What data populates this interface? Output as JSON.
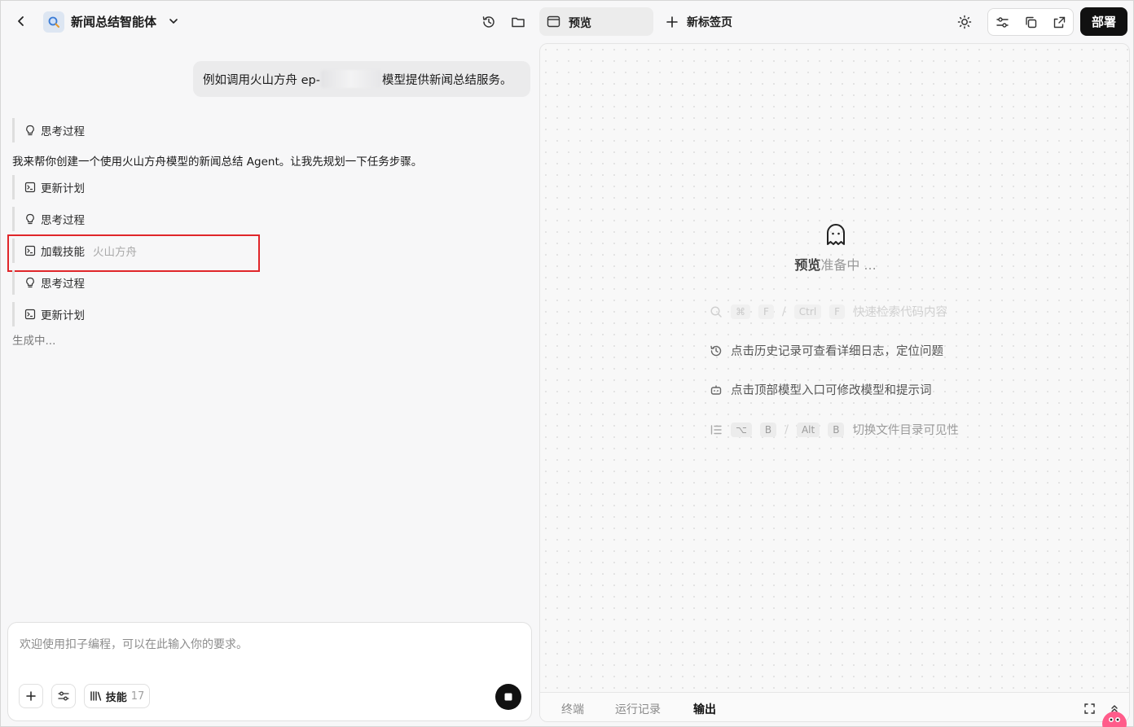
{
  "header": {
    "app_title": "新闻总结智能体",
    "tab_preview": "预览",
    "tab_new": "新标签页",
    "deploy_label": "部署"
  },
  "chat": {
    "user_message_before": "例如调用火山方舟 ep-",
    "user_message_after": "模型提供新闻总结服务。",
    "steps": [
      {
        "icon": "lightbulb-icon",
        "label": "思考过程",
        "extra": ""
      },
      {
        "icon": "terminal-icon",
        "label": "更新计划",
        "extra": ""
      },
      {
        "icon": "lightbulb-icon",
        "label": "思考过程",
        "extra": ""
      },
      {
        "icon": "terminal-icon",
        "label": "加载技能",
        "extra": "火山方舟"
      },
      {
        "icon": "lightbulb-icon",
        "label": "思考过程",
        "extra": ""
      },
      {
        "icon": "terminal-icon",
        "label": "更新计划",
        "extra": ""
      }
    ],
    "assistant_reply": "我来帮你创建一个使用火山方舟模型的新闻总结 Agent。让我先规划一下任务步骤。",
    "generating": "生成中..."
  },
  "composer": {
    "placeholder": "欢迎使用扣子编程，可以在此输入你的要求。",
    "skill_label": "技能",
    "skill_count": "17"
  },
  "preview": {
    "status_strong": "预览",
    "status_soft": "准备中 ...",
    "hints": {
      "search_keys": [
        "⌘",
        "F",
        "Ctrl",
        "F"
      ],
      "search_text": "快速检索代码内容",
      "history_text": "点击历史记录可查看详细日志，定位问题",
      "model_text": "点击顶部模型入口可修改模型和提示词",
      "tree_keys": [
        "⌥",
        "B",
        "Alt",
        "B"
      ],
      "tree_text": "切换文件目录可见性",
      "key_sep": "/"
    },
    "bottom_tabs": [
      "终端",
      "运行记录",
      "输出"
    ],
    "active_bottom_tab": "输出"
  }
}
